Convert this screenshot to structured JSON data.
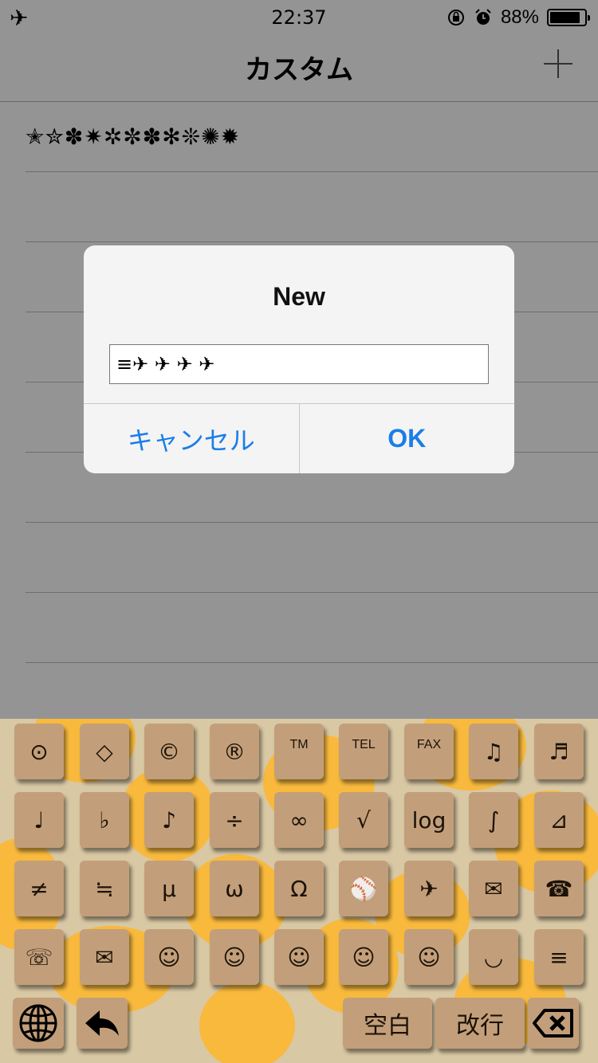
{
  "status_bar": {
    "time": "22:37",
    "battery_percent": "88%",
    "battery_level": 0.88,
    "airplane_icon": "✈",
    "rotation_lock_icon": "🔒",
    "alarm_icon": "⏰"
  },
  "nav": {
    "title": "カスタム",
    "add_icon": "plus-icon"
  },
  "list": {
    "rows": [
      "✭✮✽✷✲✼✽✻❊✺✹",
      "",
      "",
      "",
      "",
      "",
      "",
      "",
      ""
    ]
  },
  "alert": {
    "title": "New",
    "input_value": "≡✈ ✈ ✈ ✈",
    "cancel_label": "キャンセル",
    "ok_label": "OK",
    "button_color": "#1a7ee8"
  },
  "keyboard": {
    "accent_color": "#f8b93d",
    "key_color": "#c29f7a",
    "rows": [
      [
        "⊙",
        "◇",
        "©",
        "®",
        "TM",
        "TEL",
        "FAX",
        "♫",
        "♬"
      ],
      [
        "♩",
        "♭",
        "♪",
        "÷",
        "∞",
        "√",
        "log",
        "∫",
        "⊿"
      ],
      [
        "≠",
        "≒",
        "μ",
        "ω",
        "Ω",
        "⚾",
        "✈",
        "✉",
        "☎"
      ],
      [
        "☏",
        "✉",
        "☺",
        "☺",
        "☺",
        "☺",
        "☺",
        "◡",
        "≡"
      ]
    ],
    "globe_icon": "globe-icon",
    "back_icon": "back-arrow-icon",
    "space_label": "空白",
    "return_label": "改行",
    "delete_icon": "delete-icon"
  }
}
